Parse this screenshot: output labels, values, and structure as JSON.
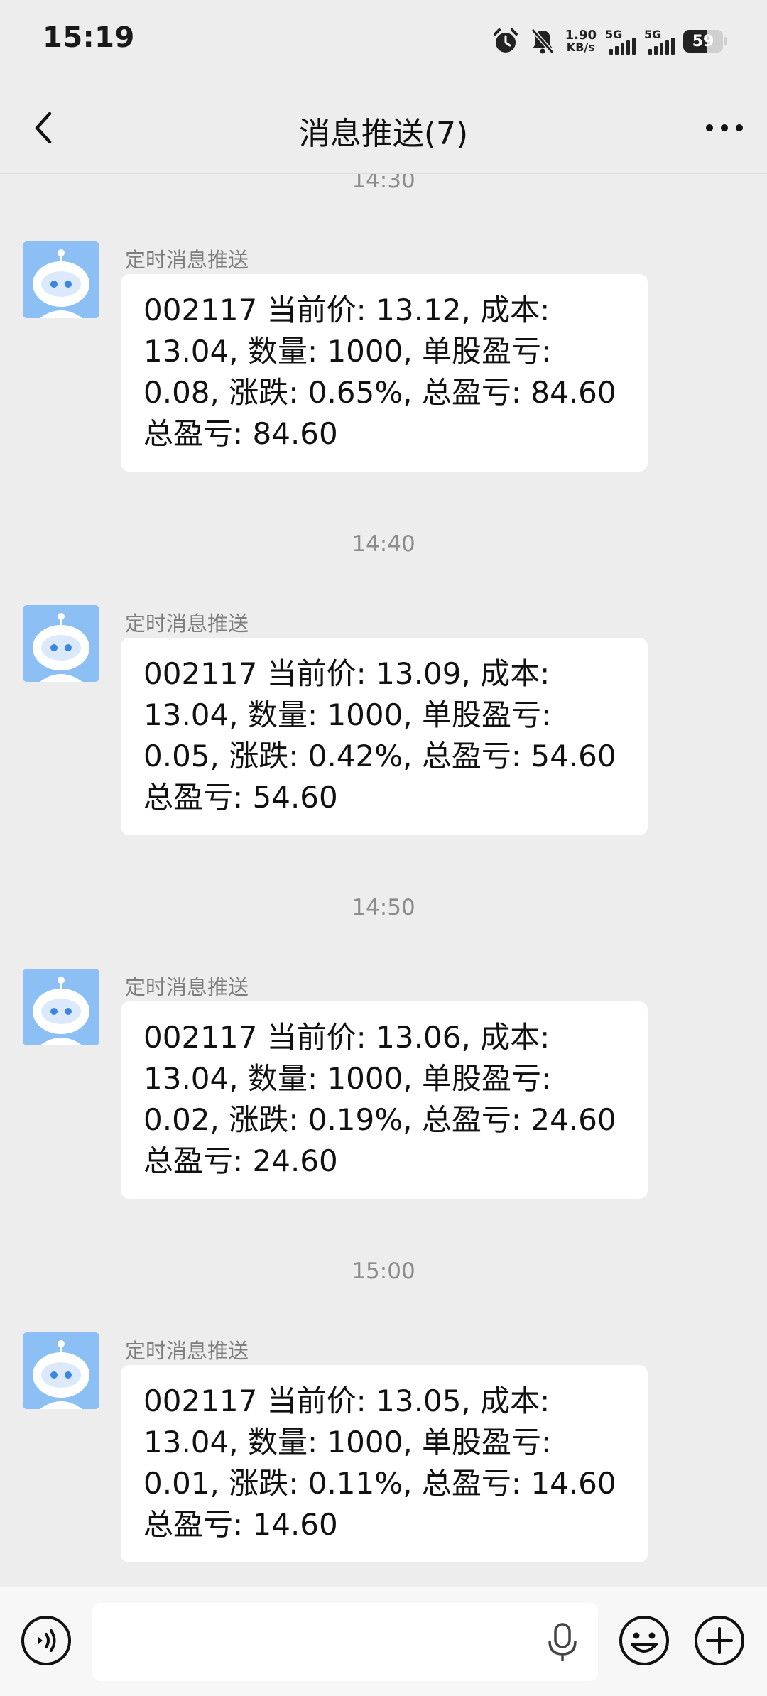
{
  "status_bar": {
    "time": "15:19",
    "net_speed_value": "1.90",
    "net_speed_unit": "KB/s",
    "sim1_label": "5G",
    "sim2_label": "5G",
    "battery_level": "59"
  },
  "header": {
    "title": "消息推送(7)"
  },
  "messages": [
    {
      "time": "14:30",
      "sender": "定时消息推送",
      "text": "002117 当前价: 13.12, 成本: 13.04, 数量: 1000, 单股盈亏: 0.08, 涨跌: 0.65%, 总盈亏: 84.60 总盈亏: 84.60"
    },
    {
      "time": "14:40",
      "sender": "定时消息推送",
      "text": "002117 当前价: 13.09, 成本: 13.04, 数量: 1000, 单股盈亏: 0.05, 涨跌: 0.42%, 总盈亏: 54.60 总盈亏: 54.60"
    },
    {
      "time": "14:50",
      "sender": "定时消息推送",
      "text": "002117 当前价: 13.06, 成本: 13.04, 数量: 1000, 单股盈亏: 0.02, 涨跌: 0.19%, 总盈亏: 24.60 总盈亏: 24.60"
    },
    {
      "time": "15:00",
      "sender": "定时消息推送",
      "text": "002117 当前价: 13.05, 成本: 13.04, 数量: 1000, 单股盈亏: 0.01, 涨跌: 0.11%, 总盈亏: 14.60 总盈亏: 14.60"
    }
  ],
  "input_bar": {
    "text_value": "",
    "placeholder": ""
  },
  "colors": {
    "background": "#ededed",
    "bubble": "#ffffff",
    "avatar_bg": "#8cc0f5",
    "timestamp_text": "#8c8c8c"
  },
  "icons": [
    "back-arrow-icon",
    "more-icon",
    "alarm-icon",
    "bell-muted-icon",
    "signal-icon",
    "battery-icon",
    "bot-avatar-icon",
    "voice-icon",
    "mic-icon",
    "emoji-icon",
    "plus-icon"
  ]
}
